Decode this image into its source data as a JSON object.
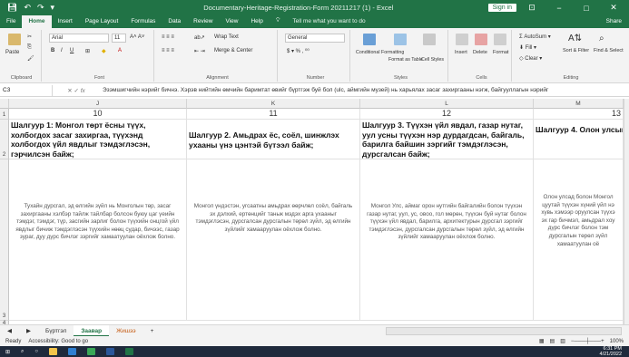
{
  "window": {
    "title": "Documentary-Heritage-Registration-Form 20211217 (1) - Excel",
    "signin": "Sign in",
    "minimize": "−",
    "restore": "□",
    "close": "✕"
  },
  "tabs": [
    "File",
    "Home",
    "Insert",
    "Page Layout",
    "Formulas",
    "Data",
    "Review",
    "View",
    "Help"
  ],
  "tell_me": "Tell me what you want to do",
  "share": "Share",
  "ribbon": {
    "paste": "Paste",
    "clipboard": "Clipboard",
    "font_name": "Arial",
    "font_size": "11",
    "font_group": "Font",
    "wrap_text": "Wrap Text",
    "merge_center": "Merge & Center",
    "alignment": "Alignment",
    "number_format": "General",
    "number": "Number",
    "conditional": "Conditional Formatting",
    "format_table": "Format as Table",
    "cell_styles": "Cell Styles",
    "styles": "Styles",
    "insert": "Insert",
    "delete": "Delete",
    "format": "Format",
    "cells": "Cells",
    "autosum": "AutoSum",
    "fill": "Fill",
    "clear": "Clear",
    "sort_filter": "Sort & Filter",
    "find_select": "Find & Select",
    "editing": "Editing"
  },
  "formula_bar": {
    "name_box": "C3",
    "fx": "fx",
    "content": "Эзэмшигчийн нэрийг бичнэ. Хэрэв нийтийн өмчийн баримтат өвийг бүртгэж буй бол (ulс, аймгийн музей) нь харьялах засаг захиргааны нэгж, байгууллагын нэрийг"
  },
  "columns": [
    "J",
    "K",
    "L",
    "M"
  ],
  "rows": [
    "1",
    "2",
    "3",
    "4",
    "5",
    "6",
    "7",
    "8"
  ],
  "row1": [
    "10",
    "11",
    "12",
    "13"
  ],
  "row2": [
    "Шалгуур 1: Монгол төрт ёсны түүх, холбогдох засаг захиргаа, түүхэнд холбогдох үйл явдлыг тэмдэглэсэн, гэрчилсэн байж;",
    "Шалгуур 2. Амьдрах ёс, соёл, шинжлэх ухааны үнэ цэнтэй бүтээл байж;",
    "Шалгуур 3. Түүхэн үйл явдал, газар нутаг, уул усны түүхэн нэр дурдагдсан, байгаль, барилга байшин зэргийг тэмдэглэсэн, дурсгалсан байж;",
    "Шалгуур 4. Олон улсын Монгол Улс, аймаг орон цуутай түүхэн хүнтэй хо"
  ],
  "row3": [
    "Тухайн дурсгал, эд өлгийн зүйл нь Монголын төр, засаг захиргааны хэлбэр тайлж тайлбар болсон буюу цаг үеийн тэмдэг, тэмдэг, түр, засгийн зарлиг болон түүхийн онцгой үйл явдлыг бичиж тэмдэглэсэн түүхийн нөөц судар, бичээс, газар зураг, дуу дүрс бичлэг зэргийг хамаатуулан оёхлож болно.",
    "Монгол үндэстэн, угсаатны амьдрах өөрчлөл соёл, байгаль эх дэлхий, ертөнцийг таньж мэдэх арга ухааныг тэмдэглэсэн, дурсгалсан дурсгалын төрөл зүйл, эд өлгийн зүйлийг хамааруулан оёхлож болно.",
    "Монгол Улс, аймаг орон нутгийн байгалийн болон түүхэн газар нутаг, уул, ус, овоо, гол мөрөн, түүхэн буй нутаг болон түүхэн үйл явдал, барилга, архитектурын дурсгал зэргийг тэмдэглэсэн, дурсгалсан дурсгалын төрөл зүйл, эд өлгийн зүйлийг хамааруулан оёхлож болно.",
    "Олон улсад болон Монгол цуутай түүхэн хүний үйл нэ хувь хэмээр оруулсан түүхэ эх гар бичмэл, амьдрал хоу дүрс бичлэг болон тэм дурсгалын төрөл зүйл хамаатуулан оё"
  ],
  "sheet_tabs": [
    "Бүртгэл",
    "Заавар",
    "Жишээ"
  ],
  "add_sheet": "+",
  "status": {
    "ready": "Ready",
    "accessibility": "Accessibility: Good to go",
    "zoom": "100%"
  },
  "clock": {
    "time": "6:31 PM",
    "date": "4/21/2022"
  },
  "colors": {
    "excel_green": "#217346",
    "taskbar": "#1f2a3c",
    "orange_tab": "#c55a11"
  }
}
